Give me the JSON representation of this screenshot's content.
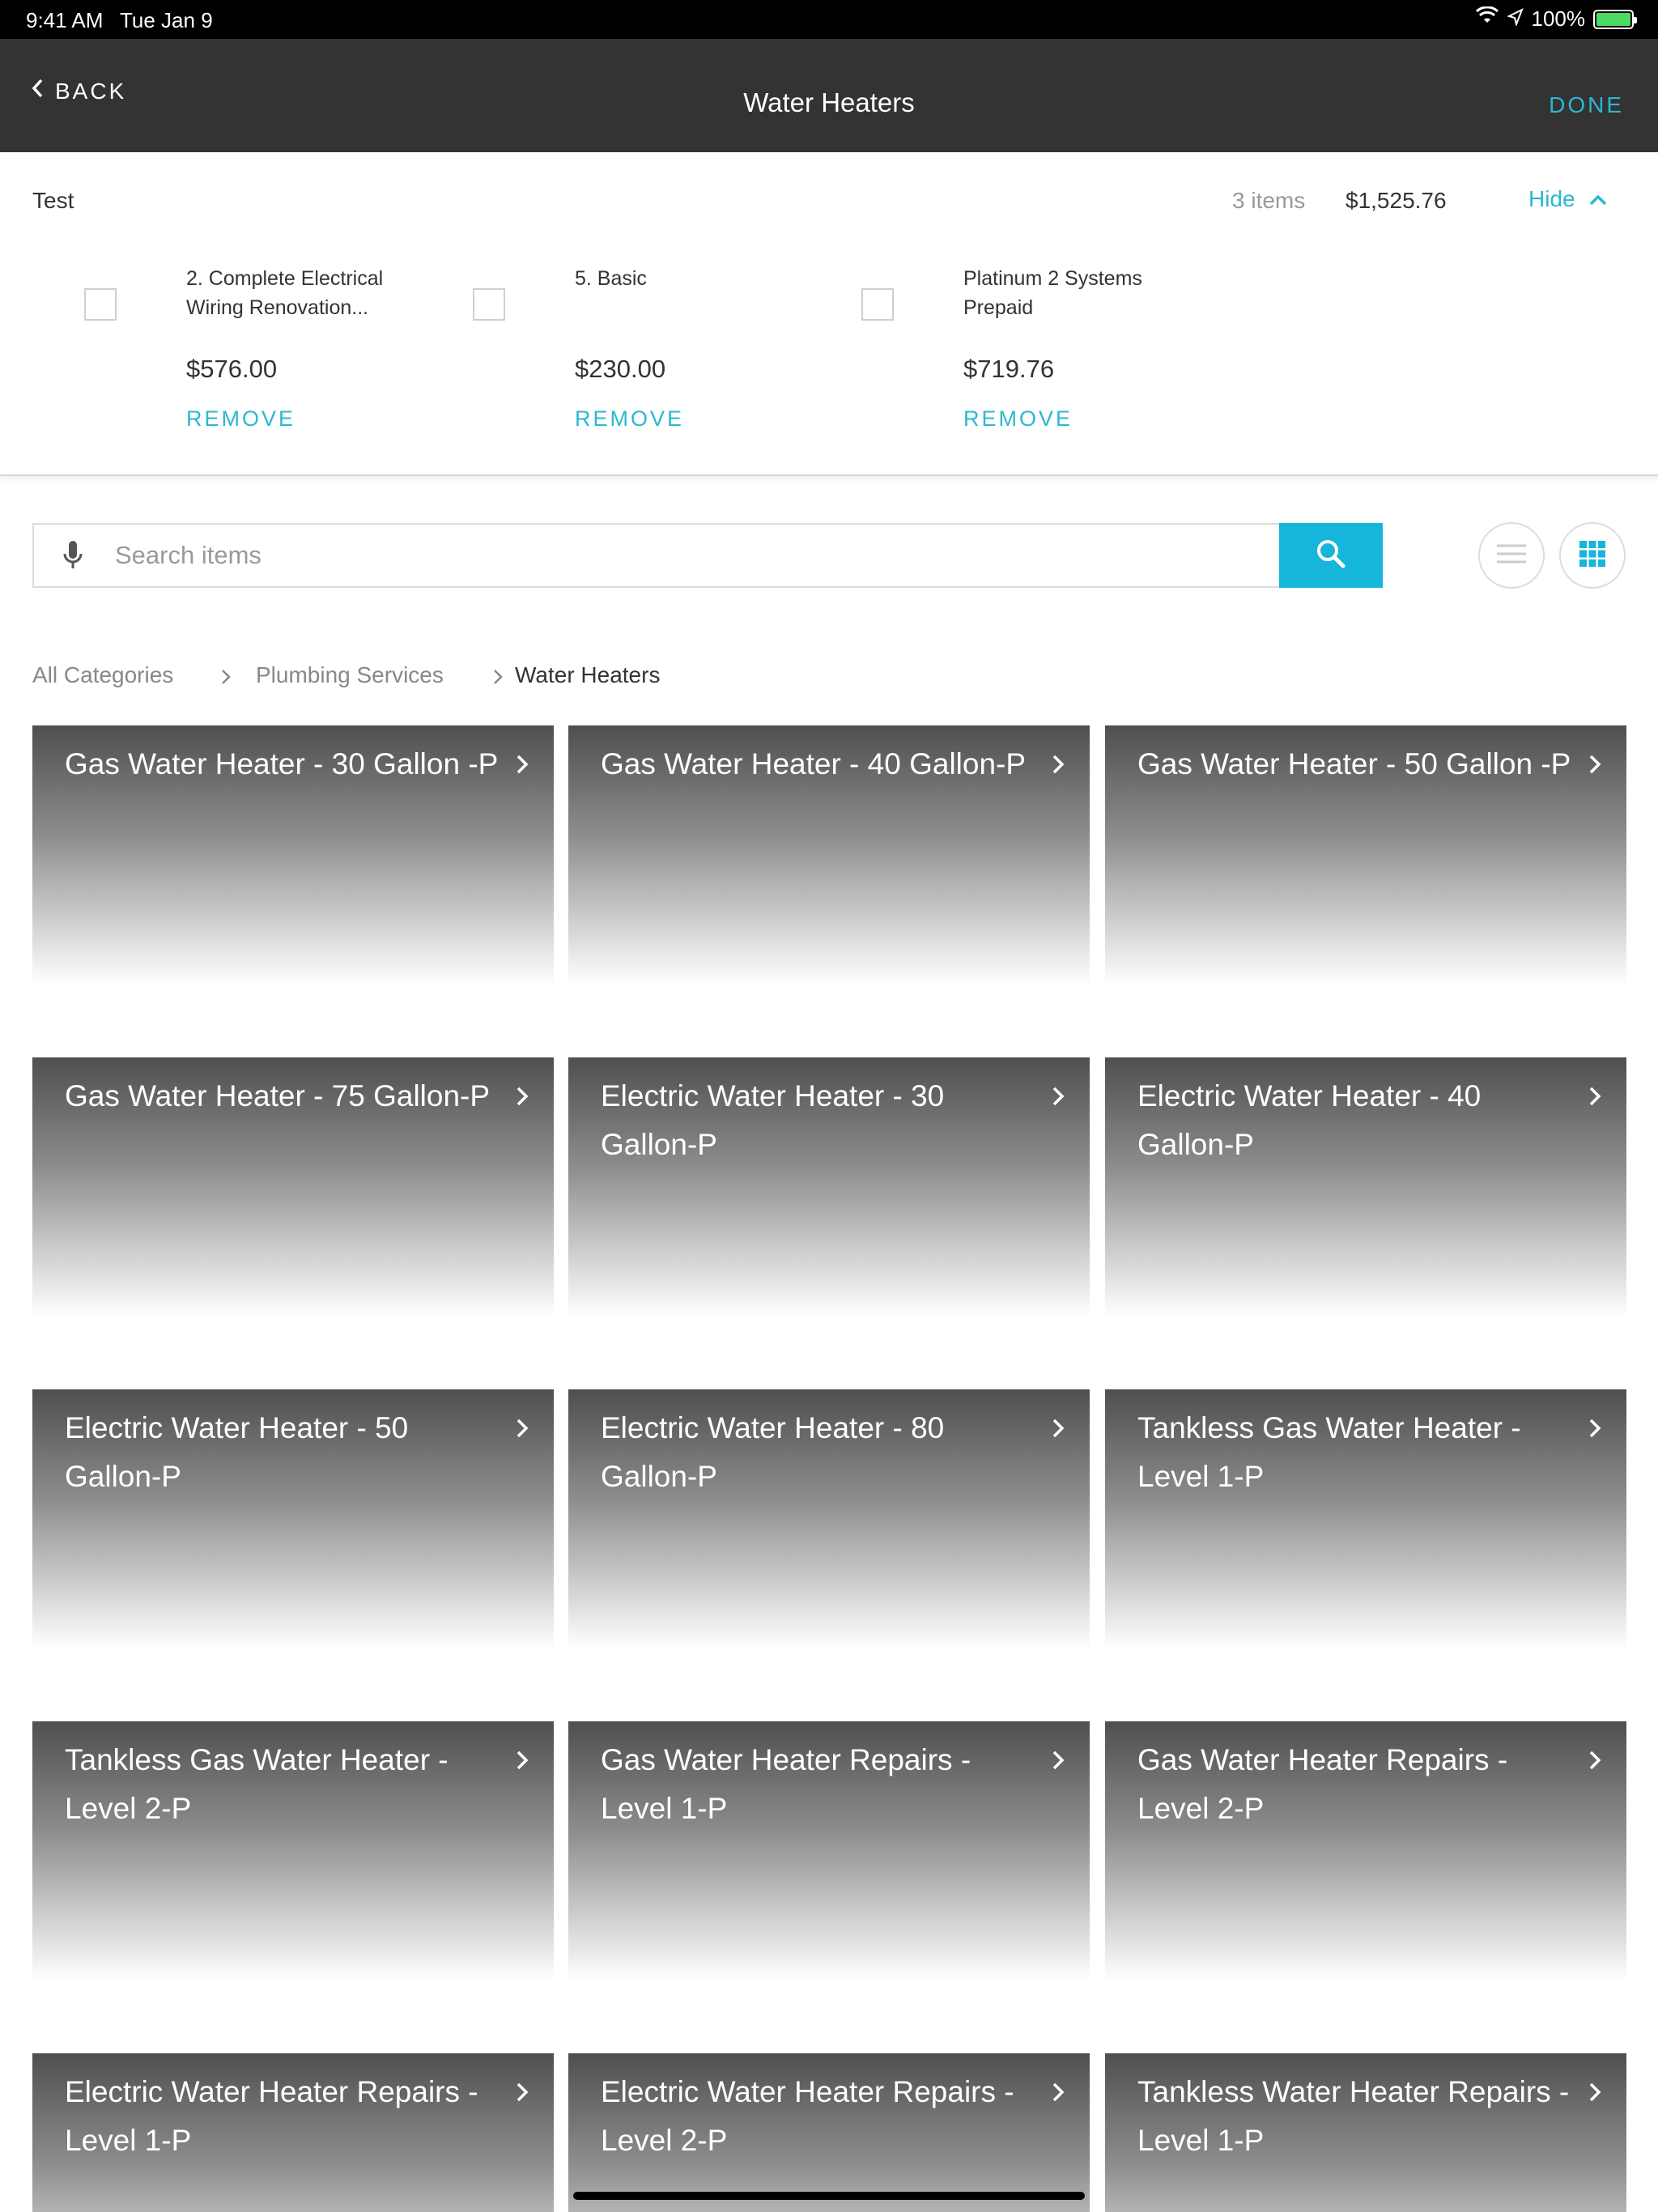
{
  "status_bar": {
    "time": "9:41 AM",
    "date": "Tue Jan 9",
    "battery": "100%"
  },
  "nav": {
    "back_label": "BACK",
    "title": "Water Heaters",
    "done_label": "DONE"
  },
  "cart": {
    "name": "Test",
    "count": "3 items",
    "total": "$1,525.76",
    "hide_label": "Hide",
    "items": [
      {
        "name": "2. Complete Electrical Wiring Renovation...",
        "price": "$576.00",
        "remove": "REMOVE"
      },
      {
        "name": "5. Basic",
        "price": "$230.00",
        "remove": "REMOVE"
      },
      {
        "name": "Platinum 2 Systems Prepaid",
        "price": "$719.76",
        "remove": "REMOVE"
      }
    ]
  },
  "search": {
    "placeholder": "Search items",
    "value": ""
  },
  "breadcrumb": [
    "All Categories",
    "Plumbing Services",
    "Water Heaters"
  ],
  "tiles": [
    "Gas Water Heater - 30 Gallon -P",
    "Gas Water Heater - 40 Gallon-P",
    "Gas Water Heater - 50 Gallon -P",
    "Gas Water Heater - 75 Gallon-P",
    "Electric Water Heater - 30 Gallon-P",
    "Electric Water Heater - 40 Gallon-P",
    "Electric Water Heater - 50 Gallon-P",
    "Electric Water Heater - 80 Gallon-P",
    "Tankless Gas Water Heater - Level 1-P",
    "Tankless Gas Water Heater - Level 2-P",
    "Gas Water Heater Repairs - Level 1-P",
    "Gas Water Heater Repairs - Level 2-P",
    "Electric Water Heater Repairs - Level 1-P",
    "Electric Water Heater Repairs - Level 2-P",
    "Tankless Water Heater Repairs - Level 1-P"
  ],
  "colors": {
    "accent": "#2bb7d2",
    "nav_bg": "#333333",
    "search_button": "#15b5dc"
  }
}
